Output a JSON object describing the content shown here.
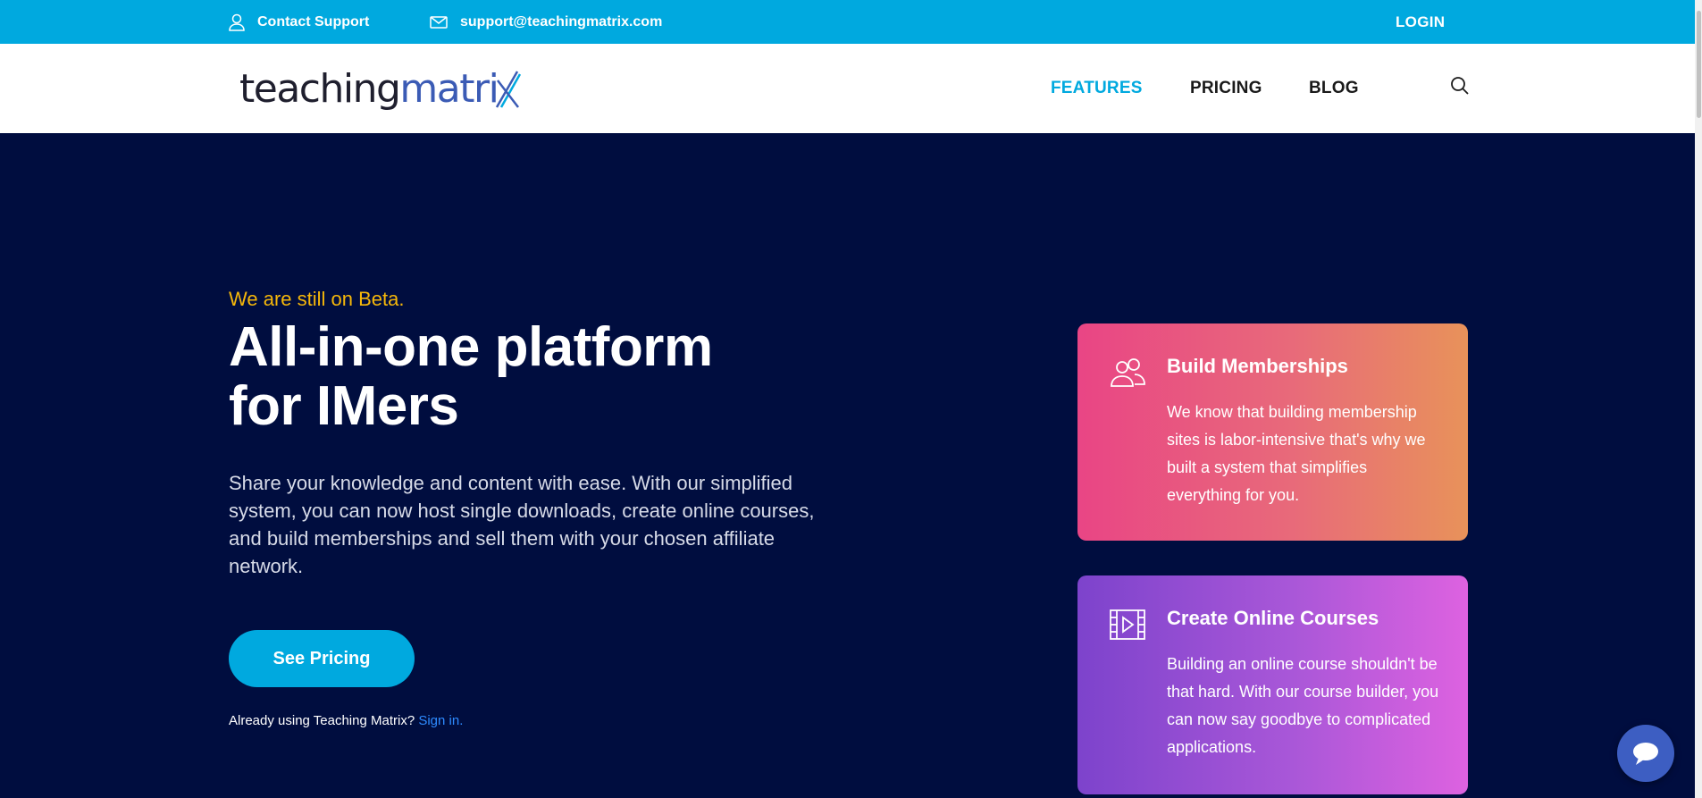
{
  "topbar": {
    "contact_label": "Contact Support",
    "email": "support@teachingmatrix.com",
    "login_label": "LOGIN"
  },
  "brand": {
    "logo_part1": "teaching",
    "logo_part2": "matri"
  },
  "nav": {
    "items": [
      {
        "label": "FEATURES",
        "active": true
      },
      {
        "label": "PRICING",
        "active": false
      },
      {
        "label": "BLOG",
        "active": false
      }
    ]
  },
  "hero": {
    "beta_text": "We are still on Beta.",
    "headline_line1": "All-in-one platform",
    "headline_line2": "for IMers",
    "description": "Share your knowledge and content with ease. With our simplified system, you can now host single downloads, create online courses, and build memberships and sell them with your chosen affiliate network.",
    "cta_label": "See Pricing",
    "signin_prompt": "Already using Teaching Matrix?",
    "signin_link": "Sign in."
  },
  "cards": [
    {
      "icon": "users-icon",
      "title": "Build Memberships",
      "text": "We know that building membership sites is labor-intensive that's why we built a system that simplifies everything for you."
    },
    {
      "icon": "video-icon",
      "title": "Create Online Courses",
      "text": "Building an online course shouldn't be that hard. With our course builder, you can now say goodbye to complicated applications."
    }
  ],
  "colors": {
    "topbar": "#00a9df",
    "hero_bg": "#000d3f",
    "beta": "#f5b70a",
    "cta": "#00a9df",
    "card1_start": "#e94585",
    "card1_end": "#e8925a",
    "card2_start": "#7d43cc",
    "card2_end": "#dd62e0"
  }
}
